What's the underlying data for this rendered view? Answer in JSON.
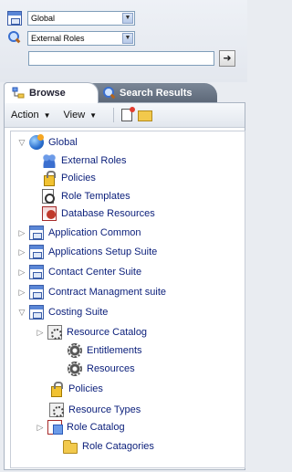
{
  "selectors": {
    "domain_value": "Global",
    "type_value": "External Roles"
  },
  "search": {
    "value": "",
    "go_label": "➜"
  },
  "tabs": [
    {
      "label": "Browse"
    },
    {
      "label": "Search Results"
    }
  ],
  "toolbar": {
    "action_label": "Action",
    "view_label": "View"
  },
  "tree": {
    "global": "Global",
    "external_roles": "External Roles",
    "policies": "Policies",
    "role_templates": "Role Templates",
    "database_resources": "Database Resources",
    "application_common": "Application Common",
    "applications_setup_suite": "Applications Setup Suite",
    "contact_center_suite": "Contact Center Suite",
    "contract_managment_suite": "Contract Managment suite",
    "costing_suite": "Costing Suite",
    "resource_catalog": "Resource Catalog",
    "entitlements": "Entitlements",
    "resources": "Resources",
    "costing_policies": "Policies",
    "resource_types": "Resource Types",
    "role_catalog": "Role Catalog",
    "role_catagories": "Role Catagories"
  }
}
